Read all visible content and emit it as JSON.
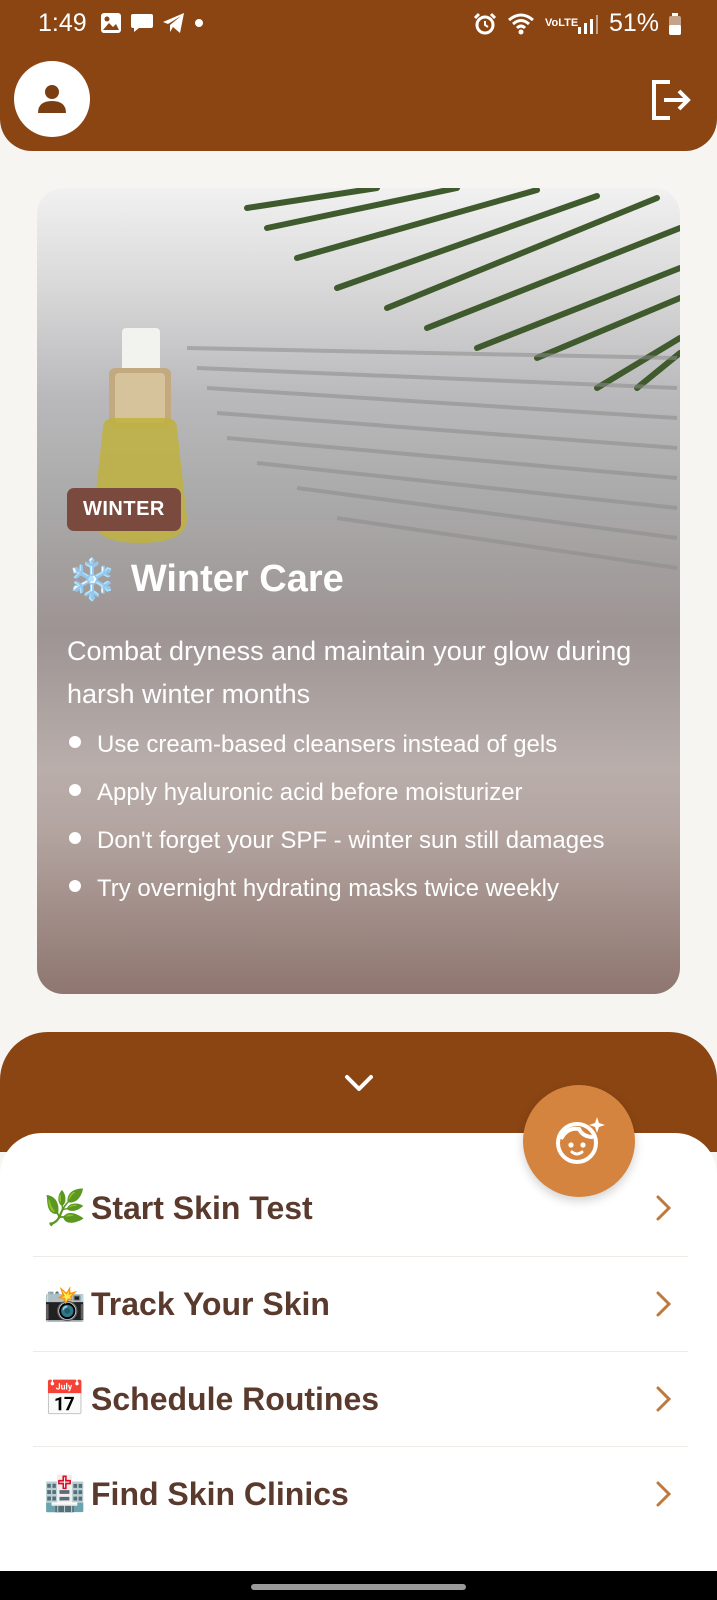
{
  "status_bar": {
    "time": "1:49",
    "network": "VoLTE",
    "battery": "51%"
  },
  "header": {
    "profile_icon": "person-icon",
    "logout_icon": "logout-icon"
  },
  "hero_card": {
    "tag": "WINTER",
    "icon": "❄️",
    "title": "Winter Care",
    "description": "Combat dryness and maintain your glow during harsh winter months",
    "tips": [
      "Use cream-based cleansers instead of gels",
      "Apply hyaluronic acid before moisturizer",
      "Don't forget your SPF - winter sun still damages",
      "Try overnight hydrating masks twice weekly"
    ]
  },
  "sheet": {
    "collapse_icon": "chevron-down-icon",
    "fab_icon": "face-sparkle-icon",
    "menu": [
      {
        "emoji": "🌿",
        "label": "Start Skin Test"
      },
      {
        "emoji": "📸",
        "label": "Track Your Skin"
      },
      {
        "emoji": "📅",
        "label": "Schedule Routines"
      },
      {
        "emoji": "🏥",
        "label": "Find Skin Clinics"
      }
    ]
  },
  "colors": {
    "brand": "#8b4513",
    "accent": "#d4843f",
    "menu_text": "#5b3a2e",
    "chevron": "#c0793a"
  }
}
